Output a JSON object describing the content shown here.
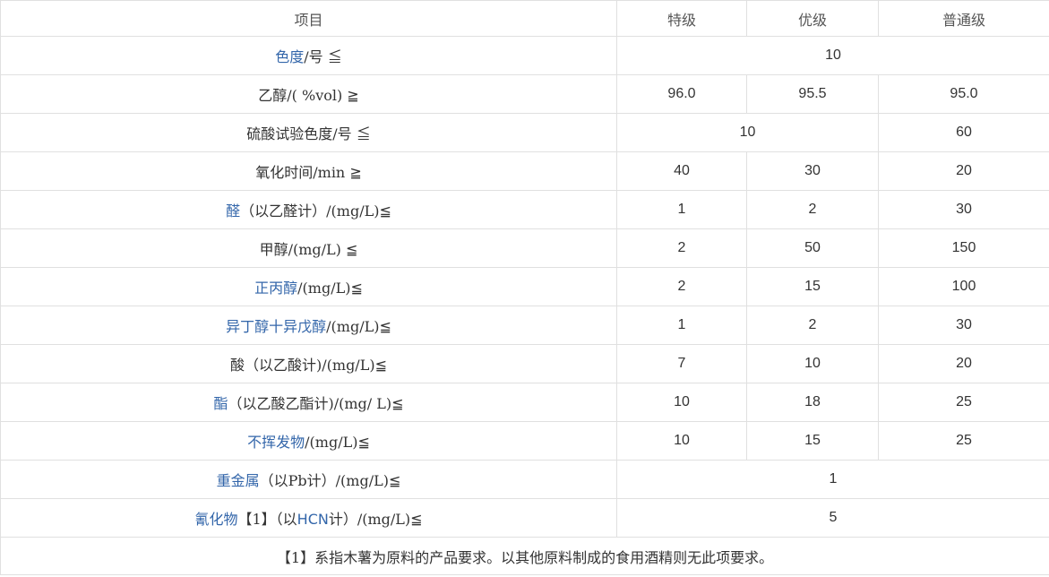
{
  "header": {
    "item": "项目",
    "grade1": "特级",
    "grade2": "优级",
    "grade3": "普通级"
  },
  "rows": [
    {
      "link": "色度",
      "rest": "/号 ≦",
      "merged": "10"
    },
    {
      "link": "",
      "rest": "乙醇/( %vol) ≧",
      "v1": "96.0",
      "v2": "95.5",
      "v3": "95.0"
    },
    {
      "link": "",
      "rest": "硫酸试验色度/号 ≦",
      "merged12": "10",
      "v3": "60"
    },
    {
      "link": "",
      "rest": "氧化时间/min ≧",
      "v1": "40",
      "v2": "30",
      "v3": "20"
    },
    {
      "link": "醛",
      "rest": "（以乙醛计）/(mg/L)≦",
      "v1": "1",
      "v2": "2",
      "v3": "30"
    },
    {
      "link": "",
      "rest": "甲醇/(mg/L) ≦",
      "v1": "2",
      "v2": "50",
      "v3": "150"
    },
    {
      "link": "正丙醇",
      "rest": "/(mg/L)≦",
      "v1": "2",
      "v2": "15",
      "v3": "100"
    },
    {
      "link": "异丁醇十异戊醇",
      "rest": "/(mg/L)≦",
      "v1": "1",
      "v2": "2",
      "v3": "30"
    },
    {
      "link": "",
      "rest": "酸（以乙酸计)/(mg/L)≦",
      "v1": "7",
      "v2": "10",
      "v3": "20"
    },
    {
      "link": "酯",
      "rest": "（以乙酸乙酯计)/(mg/ L)≦",
      "v1": "10",
      "v2": "18",
      "v3": "25"
    },
    {
      "link": "不挥发物",
      "rest": "/(mg/L)≦",
      "v1": "10",
      "v2": "15",
      "v3": "25"
    },
    {
      "link": "重金属",
      "rest": "（以Pb计）/(mg/L)≦",
      "merged": "1"
    },
    {
      "link": "氰化物",
      "mid": "【1】（以",
      "link2": "HCN",
      "rest": "计）/(mg/L)≦",
      "merged": "5"
    }
  ],
  "note": "【1】系指木薯为原料的产品要求。以其他原料制成的食用酒精则无此项要求。",
  "colors": {
    "link": "#3366aa",
    "text": "#333333",
    "border": "#e0e0e0"
  }
}
